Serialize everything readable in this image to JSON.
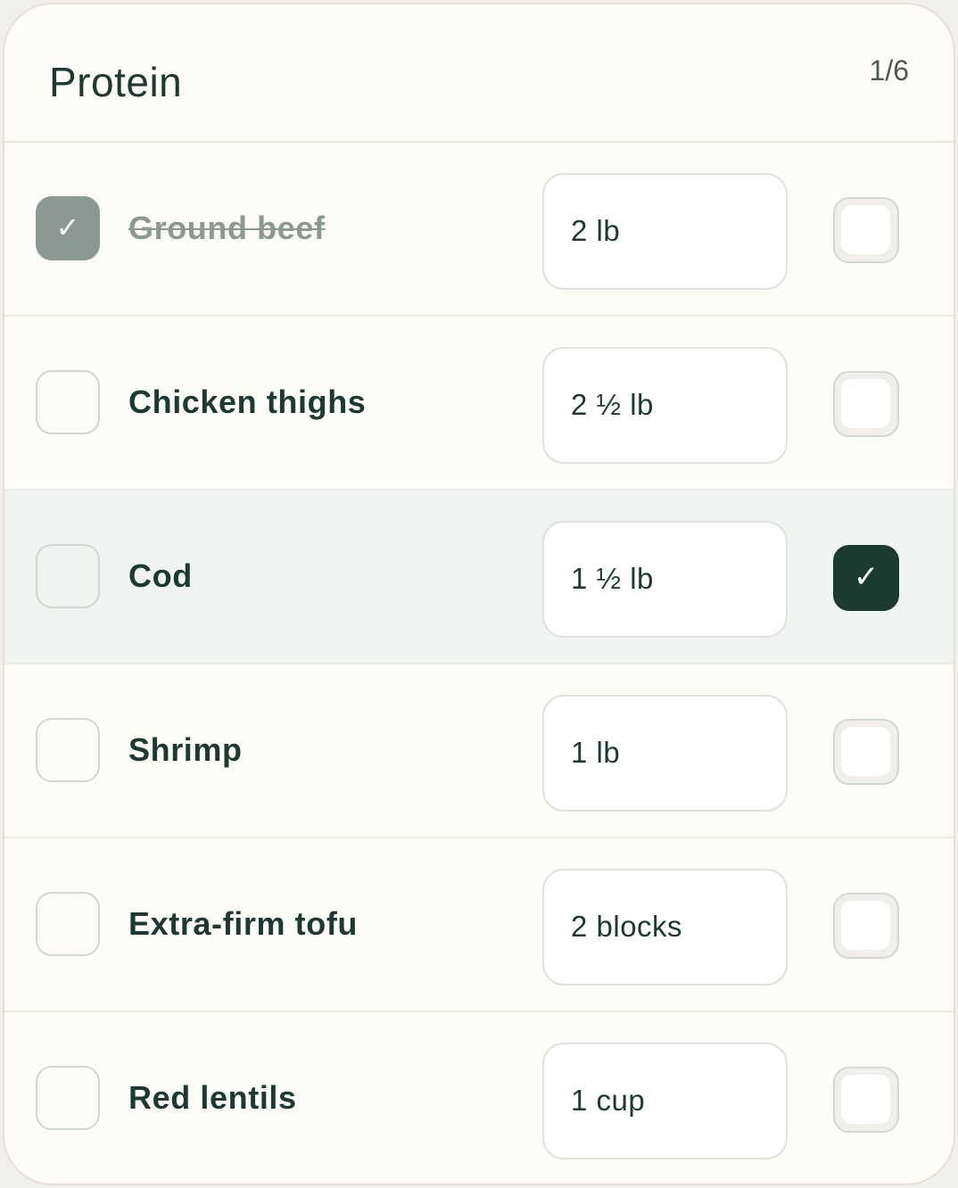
{
  "header": {
    "title": "Protein",
    "count": "1/6"
  },
  "icons": {
    "done_check": "✓",
    "selected_check": "✓"
  },
  "colors": {
    "accent": "#1a3a32",
    "muted": "#8b9993",
    "highlight_row": "#f0f4f0",
    "card_bg": "#fdfcf7"
  },
  "items": [
    {
      "name": "Ground beef",
      "qty": "2 lb",
      "checked": true,
      "selected": false
    },
    {
      "name": "Chicken thighs",
      "qty": "2 ½ lb",
      "checked": false,
      "selected": false
    },
    {
      "name": "Cod",
      "qty": "1 ½ lb",
      "checked": false,
      "selected": true
    },
    {
      "name": "Shrimp",
      "qty": "1 lb",
      "checked": false,
      "selected": false
    },
    {
      "name": "Extra-firm tofu",
      "qty": "2 blocks",
      "checked": false,
      "selected": false
    },
    {
      "name": "Red lentils",
      "qty": "1 cup",
      "checked": false,
      "selected": false
    }
  ]
}
